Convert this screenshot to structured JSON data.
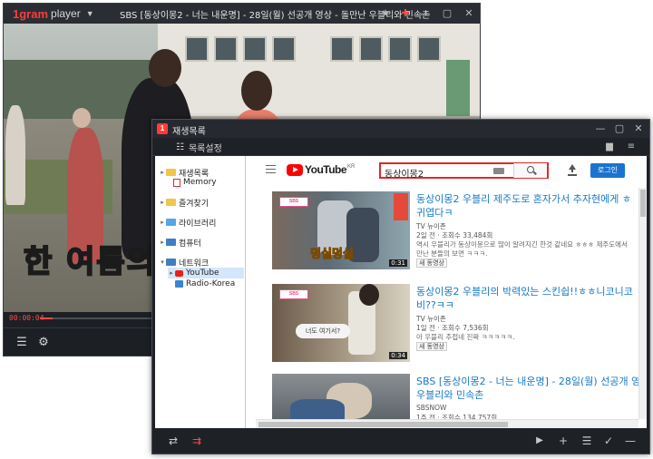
{
  "player": {
    "brand": "1gram",
    "brand_sub": "player",
    "title": "SBS [동상이몽2 - 너는 내운명] - 28일(월) 선공개 영상 - 돌만난 우블리와 민속촌",
    "subtitle": "한 여름의",
    "time": "00:00:04",
    "progress": 0.03
  },
  "playlist": {
    "title": "재생목록",
    "settings_label": "목록설정",
    "tree": [
      {
        "label": "재생목록",
        "level": 0
      },
      {
        "label": "Memory",
        "level": 1
      },
      {
        "label": "즐겨찾기",
        "level": 0
      },
      {
        "label": "라이브러리",
        "level": 0
      },
      {
        "label": "컴퓨터",
        "level": 0
      },
      {
        "label": "네트워크",
        "level": 0
      },
      {
        "label": "YouTube",
        "level": 1
      },
      {
        "label": "Radio-Korea",
        "level": 1
      }
    ]
  },
  "youtube": {
    "logo": "YouTube",
    "region": "KR",
    "search_query": "동상이몽2",
    "login_label": "로그인",
    "results": [
      {
        "title": "동상이몽2 우블리 제주도로 혼자가서 추자현에게 ㅎ 귀엽다ㅋ",
        "channel": "TV 뉴이존",
        "meta": "2일 전 · 조회수 33,484회",
        "desc": "역시 우블리가 동상이몽으로 많이 알려지긴 한것 같네요 ㅎㅎㅎ 제주도에서",
        "desc2": "만난 분들의 보면 ㅋㅋㅋ.",
        "tag": "새 동영상",
        "duration": "0:31"
      },
      {
        "title": "동상이몽2 우블리의 박력있는 스킨쉽!!ㅎㅎ니코니코 비??ㅋㅋ",
        "channel": "TV 뉴이존",
        "meta": "1일 전 · 조회수 7,536회",
        "desc": "아 우블리 추접네 진짜 ㅋㅋㅋㅋㅋ.",
        "desc2": "",
        "tag": "새 동영상",
        "duration": "0:34"
      },
      {
        "title": "SBS [동상이몽2 - 너는 내운명] - 28일(월) 선공개 영 우블리와 민속촌",
        "channel": "SBSNOW",
        "meta": "1주 전 · 조회수 134,757회",
        "desc": "",
        "desc2": "",
        "tag": "",
        "duration": ""
      }
    ],
    "thumb_texts": [
      "덩실덩실",
      "너도 여기서?"
    ]
  },
  "colors": {
    "accent_red": "#ff3b3b",
    "youtube_red": "#ff0000",
    "link_blue": "#167ac6",
    "login_blue": "#1b73cf",
    "window_dark": "#1e2126"
  },
  "icons": {
    "player_titlebar": [
      "pin-icon",
      "star-icon",
      "minimize-icon",
      "maximize-icon",
      "close-icon"
    ],
    "player_controls": [
      "playlist-icon",
      "gear-icon"
    ],
    "playlist_footer": [
      "repeat-icon",
      "shuffle-icon",
      "play-icon",
      "add-icon",
      "list-icon",
      "check-icon",
      "remove-icon"
    ]
  }
}
